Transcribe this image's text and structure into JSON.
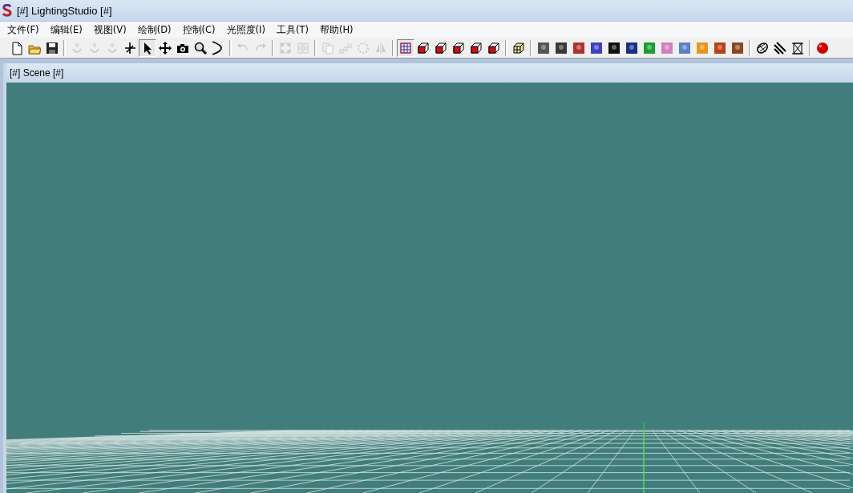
{
  "window": {
    "title": "[#] LightingStudio [#]"
  },
  "menu": [
    {
      "label": "文件(F)"
    },
    {
      "label": "编辑(E)"
    },
    {
      "label": "视图(V)"
    },
    {
      "label": "绘制(D)"
    },
    {
      "label": "控制(C)"
    },
    {
      "label": "光照度(I)"
    },
    {
      "label": "工具(T)"
    },
    {
      "label": "帮助(H)"
    }
  ],
  "toolbar": [
    {
      "kind": "document",
      "disabled": false,
      "selected": false
    },
    {
      "kind": "folder",
      "disabled": false,
      "selected": false
    },
    {
      "kind": "disk",
      "disabled": false,
      "selected": false
    },
    {
      "kind": "separator"
    },
    {
      "kind": "lamp",
      "disabled": true,
      "selected": false
    },
    {
      "kind": "lamp",
      "disabled": true,
      "selected": false
    },
    {
      "kind": "lamp",
      "disabled": true,
      "selected": false
    },
    {
      "kind": "axes",
      "disabled": false,
      "selected": false
    },
    {
      "kind": "pointer",
      "disabled": false,
      "selected": true
    },
    {
      "kind": "move",
      "disabled": false,
      "selected": false
    },
    {
      "kind": "camera",
      "disabled": false,
      "selected": false
    },
    {
      "kind": "magnifier",
      "disabled": false,
      "selected": false
    },
    {
      "kind": "arc",
      "disabled": false,
      "selected": false
    },
    {
      "kind": "separator"
    },
    {
      "kind": "undo",
      "disabled": true,
      "selected": false
    },
    {
      "kind": "redo",
      "disabled": true,
      "selected": false
    },
    {
      "kind": "separator"
    },
    {
      "kind": "group",
      "disabled": true,
      "selected": false
    },
    {
      "kind": "ungroup",
      "disabled": true,
      "selected": false
    },
    {
      "kind": "separator"
    },
    {
      "kind": "copy",
      "disabled": true,
      "selected": false
    },
    {
      "kind": "array",
      "disabled": true,
      "selected": false
    },
    {
      "kind": "ring",
      "disabled": true,
      "selected": false
    },
    {
      "kind": "mirror",
      "disabled": true,
      "selected": false
    },
    {
      "kind": "separator"
    },
    {
      "kind": "grid",
      "disabled": false,
      "selected": true
    },
    {
      "kind": "cube",
      "disabled": false,
      "selected": false
    },
    {
      "kind": "cube",
      "disabled": false,
      "selected": false
    },
    {
      "kind": "cube",
      "disabled": false,
      "selected": false
    },
    {
      "kind": "cube",
      "disabled": false,
      "selected": false
    },
    {
      "kind": "cube",
      "disabled": false,
      "selected": false
    },
    {
      "kind": "separator"
    },
    {
      "kind": "box",
      "disabled": false,
      "selected": false
    },
    {
      "kind": "separator"
    },
    {
      "kind": "swatch",
      "color": "#555555",
      "disabled": false,
      "selected": false
    },
    {
      "kind": "swatch",
      "color": "#3a3a3a",
      "disabled": false,
      "selected": false
    },
    {
      "kind": "swatch",
      "color": "#b03030",
      "disabled": false,
      "selected": false
    },
    {
      "kind": "swatch",
      "color": "#4040c0",
      "disabled": false,
      "selected": false
    },
    {
      "kind": "swatch",
      "color": "#111111",
      "disabled": false,
      "selected": false
    },
    {
      "kind": "swatch",
      "color": "#1a2f8a",
      "disabled": false,
      "selected": false
    },
    {
      "kind": "swatch",
      "color": "#18a030",
      "disabled": false,
      "selected": false
    },
    {
      "kind": "swatch",
      "color": "#d080c0",
      "disabled": false,
      "selected": false
    },
    {
      "kind": "swatch",
      "color": "#5a80c8",
      "disabled": false,
      "selected": false
    },
    {
      "kind": "swatch",
      "color": "#e8961e",
      "disabled": false,
      "selected": false
    },
    {
      "kind": "swatch",
      "color": "#b8401a",
      "disabled": false,
      "selected": false
    },
    {
      "kind": "swatch",
      "color": "#8a4a20",
      "disabled": false,
      "selected": false
    },
    {
      "kind": "separator"
    },
    {
      "kind": "lattice",
      "disabled": false,
      "selected": false
    },
    {
      "kind": "stripes",
      "disabled": false,
      "selected": false
    },
    {
      "kind": "frame",
      "disabled": false,
      "selected": false
    },
    {
      "kind": "separator"
    },
    {
      "kind": "ball",
      "disabled": false,
      "selected": false
    }
  ],
  "scene": {
    "title": "[#] Scene [#]"
  }
}
